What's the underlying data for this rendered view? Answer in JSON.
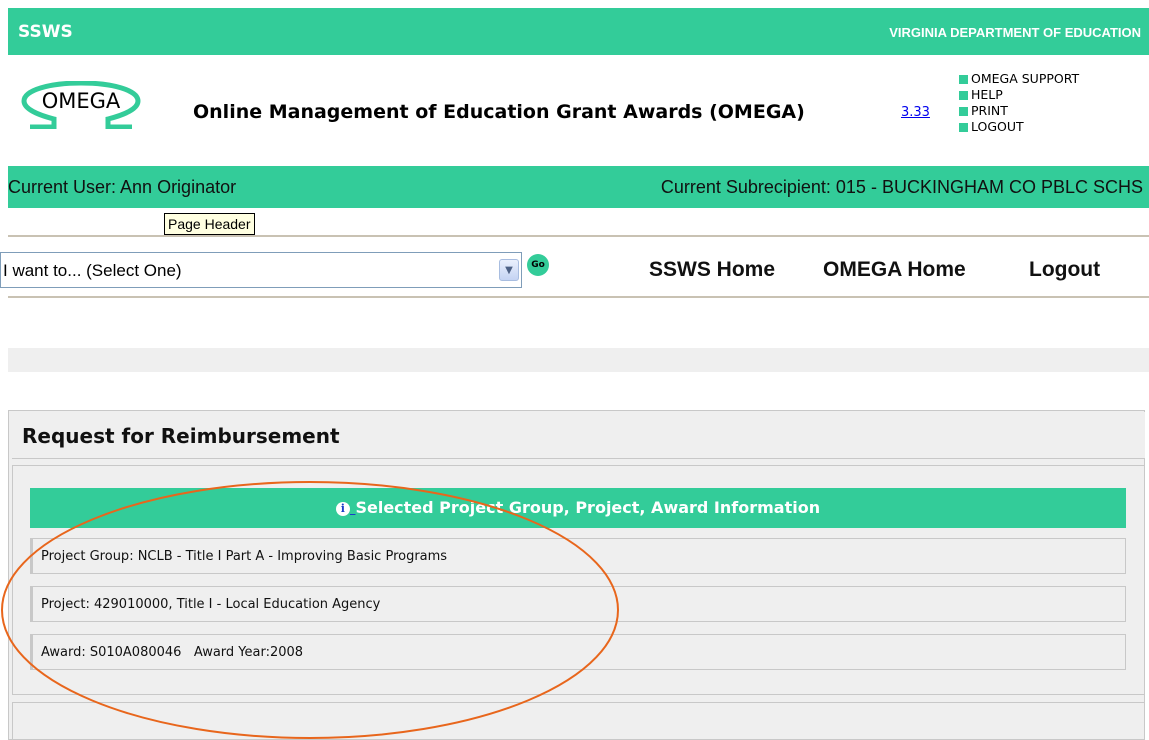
{
  "topbar": {
    "app_name": "SSWS",
    "department": "VIRGINIA DEPARTMENT OF EDUCATION"
  },
  "header": {
    "logo_text": "OMEGA",
    "title": "Online Management of Education Grant Awards (OMEGA)",
    "version": "3.33",
    "quick_links": [
      "OMEGA SUPPORT",
      "HELP",
      "PRINT",
      "LOGOUT"
    ]
  },
  "user_bar": {
    "current_user": "Current User: Ann Originator",
    "current_subrecipient": "Current Subrecipient: 015 - BUCKINGHAM CO PBLC SCHS"
  },
  "tooltip": {
    "text": "Page Header"
  },
  "nav": {
    "select_value": "I want to... (Select One)",
    "go_label": "Go",
    "links": [
      "SSWS Home",
      "OMEGA Home",
      "Logout"
    ]
  },
  "page": {
    "title": "Request for Reimbursement",
    "section_title": "Selected Project Group, Project, Award Information",
    "info_icon": "i",
    "project_group": "Project Group: NCLB - Title I Part A - Improving Basic Programs",
    "project": "Project: 429010000, Title I - Local Education Agency",
    "award": "Award: S010A080046   Award Year:2008"
  },
  "colors": {
    "brand_green": "#33cc99",
    "annotation_orange": "#e8661c"
  }
}
